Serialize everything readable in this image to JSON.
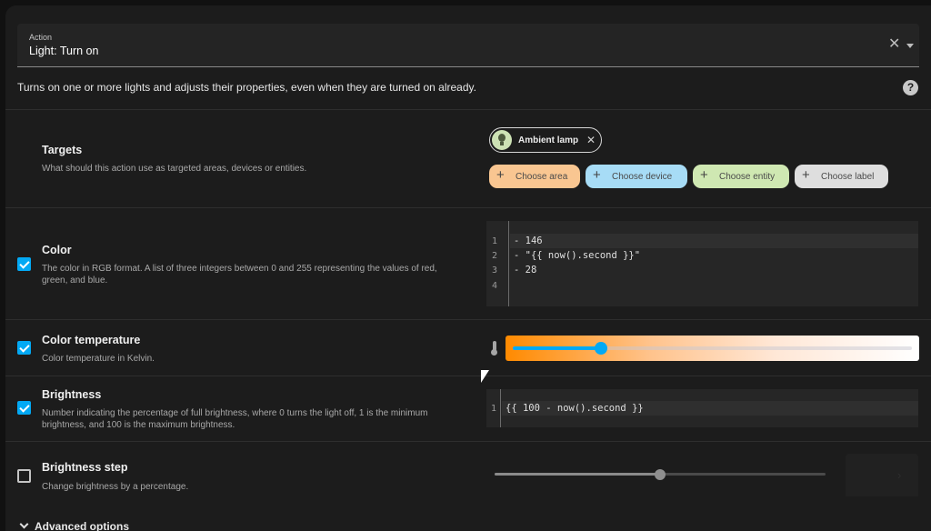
{
  "action": {
    "label": "Action",
    "value": "Light: Turn on"
  },
  "description": "Turns on one or more lights and adjusts their properties, even when they are turned on already.",
  "targets": {
    "title": "Targets",
    "subtitle": "What should this action use as targeted areas, devices or entities.",
    "selected": [
      {
        "name": "Ambient lamp",
        "icon": "lightbulb-icon"
      }
    ],
    "choose": {
      "area": "Choose area",
      "device": "Choose device",
      "entity": "Choose entity",
      "label": "Choose label"
    }
  },
  "color": {
    "title": "Color",
    "subtitle": "The color in RGB format. A list of three integers between 0 and 255 representing the values of red, green, and blue.",
    "checked": true,
    "code_lines": [
      {
        "n": "1",
        "text": "- 146"
      },
      {
        "n": "2",
        "text": "- \"{{ now().second }}\""
      },
      {
        "n": "3",
        "text": "- 28"
      },
      {
        "n": "4",
        "text": ""
      }
    ]
  },
  "color_temperature": {
    "title": "Color temperature",
    "subtitle": "Color temperature in Kelvin.",
    "checked": true,
    "value_fraction": 0.22
  },
  "brightness": {
    "title": "Brightness",
    "subtitle": "Number indicating the percentage of full brightness, where 0 turns the light off, 1 is the minimum brightness, and 100 is the maximum brightness.",
    "checked": true,
    "code_lines": [
      {
        "n": "1",
        "text": "{{ 100 - now().second }}"
      }
    ]
  },
  "brightness_step": {
    "title": "Brightness step",
    "subtitle": "Change brightness by a percentage.",
    "checked": false,
    "value_fraction": 0.5
  },
  "advanced": "Advanced options",
  "colors": {
    "accent": "#03a9f4",
    "area_chip": "#f9c691",
    "device_chip": "#a7dcf6",
    "entity_chip": "#cfe8b2",
    "label_chip": "#dedede"
  }
}
